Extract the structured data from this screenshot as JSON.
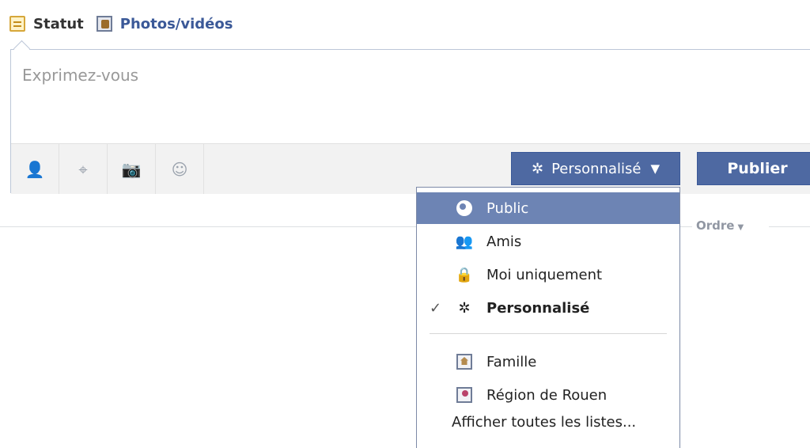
{
  "tabs": {
    "status_label": "Statut",
    "photos_label": "Photos/vidéos"
  },
  "composer": {
    "placeholder": "Exprimez-vous",
    "audience_label": "Personnalisé",
    "publish_label": "Publier"
  },
  "sort": {
    "label": "Ordre"
  },
  "menu": {
    "items": [
      {
        "label": "Public",
        "icon": "globe-icon",
        "selected": true
      },
      {
        "label": "Amis",
        "icon": "friends-icon"
      },
      {
        "label": "Moi uniquement",
        "icon": "lock-icon"
      },
      {
        "label": "Personnalisé",
        "icon": "gear-icon",
        "checked": true
      }
    ],
    "lists": [
      {
        "label": "Famille",
        "icon": "house-icon"
      },
      {
        "label": "Région de Rouen",
        "icon": "location-pin-icon"
      }
    ],
    "show_all_label": "Afficher toutes les listes..."
  },
  "colors": {
    "brand_blue": "#3b5998",
    "button_blue": "#4e69a2",
    "selected_menu": "#6d84b4"
  }
}
